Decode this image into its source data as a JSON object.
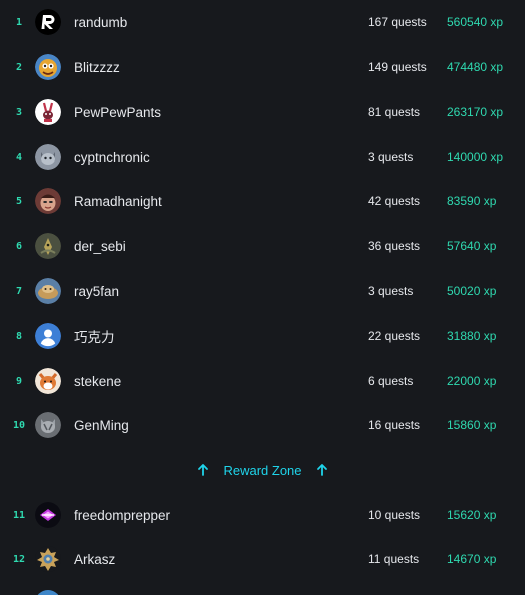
{
  "leaderboard": {
    "rows": [
      {
        "rank": "1",
        "name": "randumb",
        "quests": "167 quests",
        "xp": "560540 xp",
        "avatar": "logo-r-avatar"
      },
      {
        "rank": "2",
        "name": "Blitzzzz",
        "quests": "149 quests",
        "xp": "474480 xp",
        "avatar": "cartoon-avatar"
      },
      {
        "rank": "3",
        "name": "PewPewPants",
        "quests": "81 quests",
        "xp": "263170 xp",
        "avatar": "bunny-avatar"
      },
      {
        "rank": "4",
        "name": "cyptnchronic",
        "quests": "3 quests",
        "xp": "140000 xp",
        "avatar": "cat-avatar"
      },
      {
        "rank": "5",
        "name": "Ramadhanight",
        "quests": "42 quests",
        "xp": "83590 xp",
        "avatar": "face-avatar"
      },
      {
        "rank": "6",
        "name": "der_sebi",
        "quests": "36 quests",
        "xp": "57640 xp",
        "avatar": "animal-avatar"
      },
      {
        "rank": "7",
        "name": "ray5fan",
        "quests": "3 quests",
        "xp": "50020 xp",
        "avatar": "photo-avatar"
      },
      {
        "rank": "8",
        "name": "巧克力",
        "quests": "22 quests",
        "xp": "31880 xp",
        "avatar": "default-user-avatar"
      },
      {
        "rank": "9",
        "name": "stekene",
        "quests": "6 quests",
        "xp": "22000 xp",
        "avatar": "fox-avatar"
      },
      {
        "rank": "10",
        "name": "GenMing",
        "quests": "16 quests",
        "xp": "15860 xp",
        "avatar": "grey-cat-avatar"
      },
      {
        "rank": "11",
        "name": "freedomprepper",
        "quests": "10 quests",
        "xp": "15620 xp",
        "avatar": "neon-emblem-avatar"
      },
      {
        "rank": "12",
        "name": "Arkasz",
        "quests": "11 quests",
        "xp": "14670 xp",
        "avatar": "tribal-mask-avatar"
      }
    ],
    "reward_zone_label": "Reward Zone"
  },
  "colors": {
    "background": "#17191d",
    "accent_green": "#2fd9b0",
    "reward_cyan": "#1fd4ea",
    "text": "#e6e8ec"
  },
  "icons": {
    "reward_arrow": "arrow-up-icon"
  }
}
